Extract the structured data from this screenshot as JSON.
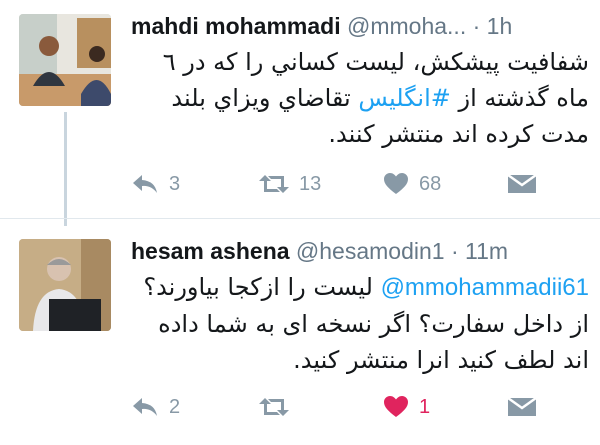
{
  "tweets": [
    {
      "display_name": "mahdi mohammadi",
      "handle": "@mmoha...",
      "dot": "·",
      "time": "1h",
      "text_parts": [
        "شفافيت پيشكش، ليست كساني را كه در ٦ ماه گذشته از ",
        "#انگليس",
        " تقاضاي ويزاي بلند مدت كرده اند منتشر كنند."
      ],
      "actions": {
        "replies": "3",
        "retweets": "13",
        "likes": "68"
      },
      "liked": false
    },
    {
      "display_name": "hesam ashena",
      "handle": "@hesamodin1",
      "dot": "·",
      "time": "11m",
      "text_parts": [
        "@mmohammadii61",
        " ليست را ازكجا بياورند؟ از داخل سفارت؟ اگر نسخه اى به شما داده اند لطف كنيد انرا منتشر كنيد."
      ],
      "actions": {
        "replies": "2",
        "retweets": "",
        "likes": "1"
      },
      "liked": true
    }
  ],
  "colors": {
    "accent": "#1da1f2",
    "muted": "#8899a6",
    "like": "#e0245e",
    "thread_line": "#c9d5de"
  },
  "icons": [
    "reply-icon",
    "retweet-icon",
    "heart-icon",
    "direct-message-icon"
  ]
}
